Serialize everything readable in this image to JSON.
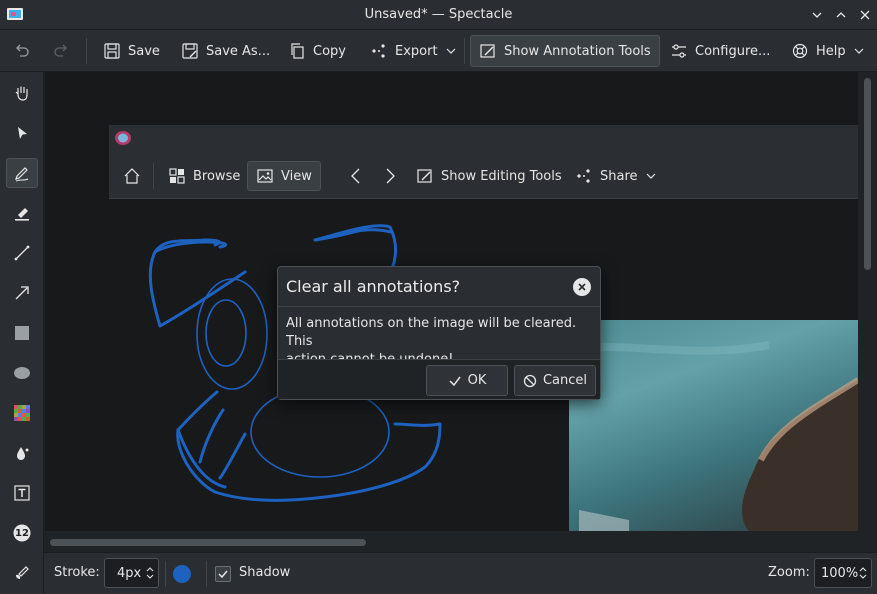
{
  "window": {
    "title": "Unsaved* — Spectacle"
  },
  "toolbar": {
    "save": "Save",
    "save_as": "Save As...",
    "copy": "Copy",
    "export": "Export",
    "show_annotation_tools": "Show Annotation Tools",
    "configure": "Configure...",
    "help": "Help"
  },
  "gwenview": {
    "browse": "Browse",
    "view": "View",
    "show_editing_tools": "Show Editing Tools",
    "share": "Share"
  },
  "dialog": {
    "title": "Clear all annotations?",
    "message_line1": "All annotations on the image will be cleared. This",
    "message_line2": "action cannot be undone!",
    "ok": "OK",
    "cancel": "Cancel"
  },
  "bottom": {
    "stroke_label": "Stroke:",
    "stroke_value": "4px",
    "shadow_label": "Shadow",
    "shadow_checked": true,
    "color": "#1e62c0",
    "zoom_label": "Zoom:",
    "zoom_value": "100%"
  },
  "sidebar": {
    "number_tool": "12"
  },
  "colors": {
    "accent": "#3daee9",
    "annotation_stroke": "#1e62c0"
  }
}
